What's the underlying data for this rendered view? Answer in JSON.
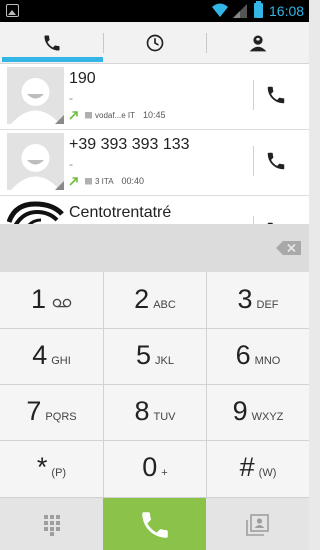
{
  "status_bar": {
    "time": "16:08",
    "accent": "#33b5e5"
  },
  "tabs": [
    {
      "name": "phone-icon",
      "active": true
    },
    {
      "name": "clock-icon",
      "active": false
    },
    {
      "name": "contact-icon",
      "active": false
    }
  ],
  "call_log": [
    {
      "name": "190",
      "sub": "-",
      "carrier": "vodaf...e IT",
      "time": "10:45",
      "call_type": "outgoing"
    },
    {
      "name": "+39 393 393 133",
      "sub": "-",
      "carrier": "3 ITA",
      "time": "00:40",
      "call_type": "outgoing"
    },
    {
      "name": "Centotrentatré"
    }
  ],
  "keypad": [
    {
      "digit": "1",
      "letters": ""
    },
    {
      "digit": "2",
      "letters": "ABC"
    },
    {
      "digit": "3",
      "letters": "DEF"
    },
    {
      "digit": "4",
      "letters": "GHI"
    },
    {
      "digit": "5",
      "letters": "JKL"
    },
    {
      "digit": "6",
      "letters": "MNO"
    },
    {
      "digit": "7",
      "letters": "PQRS"
    },
    {
      "digit": "8",
      "letters": "TUV"
    },
    {
      "digit": "9",
      "letters": "WXYZ"
    },
    {
      "digit": "*",
      "letters": "(P)"
    },
    {
      "digit": "0",
      "letters": "+"
    },
    {
      "digit": "#",
      "letters": "(W)"
    }
  ],
  "colors": {
    "call_green": "#8bc34a",
    "outgoing_arrow": "#6fbf3a"
  }
}
